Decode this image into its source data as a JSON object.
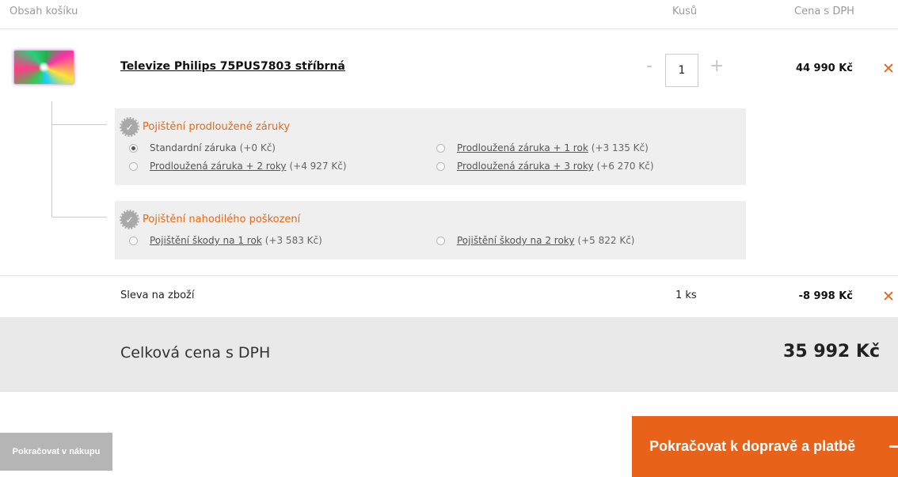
{
  "header": {
    "cart_contents": "Obsah košíku",
    "quantity": "Kusů",
    "price_with_vat": "Cena s DPH"
  },
  "product": {
    "name": "Televize Philips 75PUS7803 stříbrná",
    "quantity": "1",
    "qty_minus": "-",
    "qty_plus": "+",
    "price": "44 990 Kč",
    "remove": "✕",
    "thumbnail_icon": "tv-thumbnail"
  },
  "warranty": {
    "title": "Pojištění prodloužené záruky",
    "icon": "check-badge-icon",
    "options": [
      {
        "label": "Standardní záruka",
        "extra": "(+0 Kč)",
        "selected": true
      },
      {
        "label": "Prodloužená záruka + 1 rok",
        "extra": "(+3 135 Kč)",
        "selected": false
      },
      {
        "label": "Prodloužená záruka + 2 roky",
        "extra": "(+4 927 Kč)",
        "selected": false
      },
      {
        "label": "Prodloužená záruka + 3 roky",
        "extra": "(+6 270 Kč)",
        "selected": false
      }
    ]
  },
  "damage": {
    "title": "Pojištění nahodilého poškození",
    "icon": "check-badge-icon",
    "options": [
      {
        "label": "Pojištění škody na 1 rok",
        "extra": "(+3 583 Kč)",
        "selected": false
      },
      {
        "label": "Pojištění škody na 2 roky",
        "extra": "(+5 822 Kč)",
        "selected": false
      }
    ]
  },
  "discount": {
    "label": "Sleva na zboží",
    "quantity": "1 ks",
    "price": "-8 998 Kč",
    "remove": "✕"
  },
  "total": {
    "label": "Celková cena s DPH",
    "value": "35 992 Kč"
  },
  "buttons": {
    "continue_shopping": "Pokračovat v nákupu",
    "continue_checkout": "Pokračovat k dopravě a platbě"
  },
  "colors": {
    "accent": "#e8621a",
    "secondary_button": "#b5b5b5",
    "panel": "#efefef"
  }
}
